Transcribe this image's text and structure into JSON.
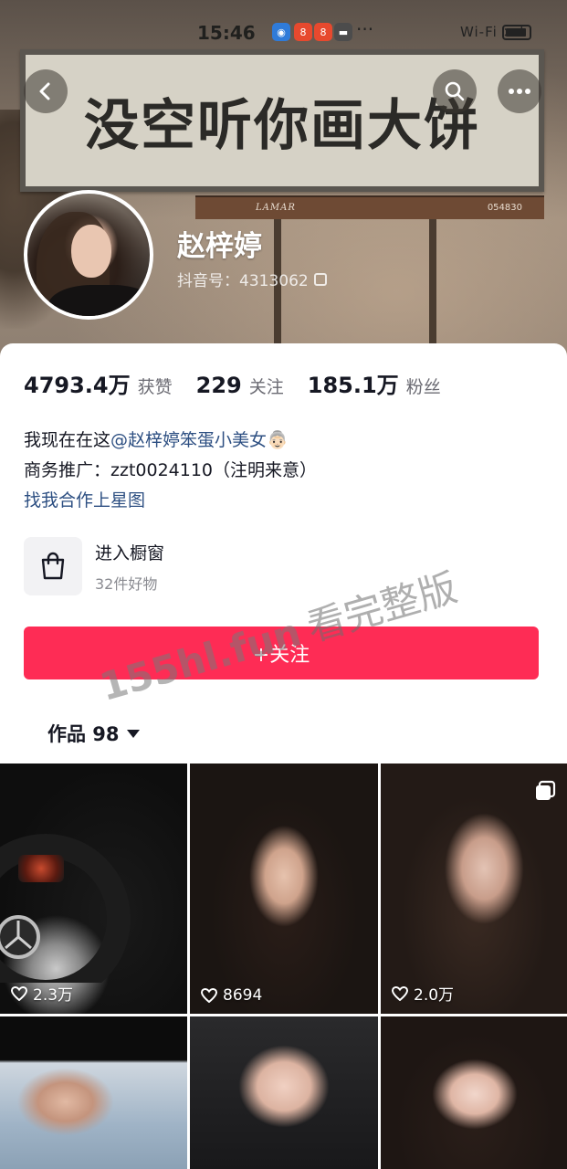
{
  "status_bar": {
    "time": "15:46",
    "app_badges": [
      "safari-badge",
      "app-badge-1",
      "app-badge-2",
      "app-badge-3"
    ],
    "more": "···",
    "signal": "Wi-Fi ×ıl"
  },
  "cover": {
    "slogan": "没空听你画大饼",
    "billboard_brand": "LAMAR",
    "billboard_code": "054830"
  },
  "profile": {
    "nickname": "赵梓婷",
    "douyin_id": "抖音号：4313062"
  },
  "stats": [
    {
      "num": "4793.4万",
      "label": "获赞"
    },
    {
      "num": "229",
      "label": "关注"
    },
    {
      "num": "185.1万",
      "label": "粉丝"
    }
  ],
  "bio": {
    "line1_prefix": "我现在在这",
    "line1_mention": "@赵梓婷笨蛋小美女",
    "line1_emoji": "👵🏻",
    "line2": "商务推广：zzt0024110（注明来意）",
    "link": "找我合作上星图"
  },
  "shop": {
    "title": "进入橱窗",
    "subtitle": "32件好物"
  },
  "follow_button": "+关注",
  "works_tab": "作品 98",
  "watermark": {
    "site": "155hl.fun",
    "cn": "看完整版"
  },
  "grid": [
    {
      "likes": "2.3万"
    },
    {
      "likes": "8694"
    },
    {
      "likes": "2.0万"
    },
    {
      "likes": ""
    },
    {
      "likes": ""
    },
    {
      "likes": ""
    }
  ],
  "colors": {
    "accent": "#fe2c55",
    "link": "#2d4f82",
    "text_primary": "#161823",
    "text_secondary": "#6b6b73"
  },
  "icons": {
    "back": "chevron-left-icon",
    "search": "search-icon",
    "more": "more-horizontal-icon",
    "copy": "copy-icon",
    "shop": "shopping-bag-icon",
    "caret": "caret-down-icon",
    "heart": "heart-outline-icon",
    "multi": "multi-image-icon"
  }
}
